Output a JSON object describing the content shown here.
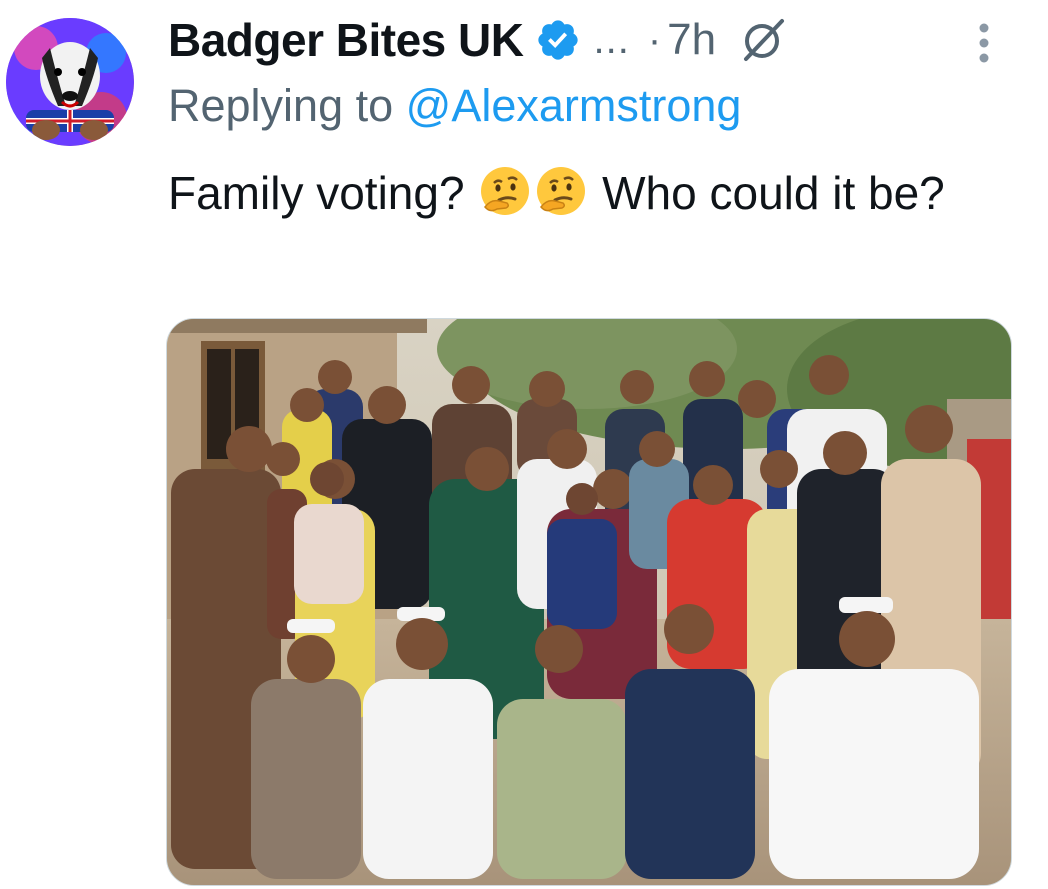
{
  "author": {
    "display_name": "Badger Bites UK",
    "verified": true,
    "avatar_icon": "badger-avatar-icon"
  },
  "meta": {
    "ellipsis": "...",
    "separator": "·",
    "timestamp": "7h"
  },
  "reply": {
    "prefix": "Replying to",
    "handle": "@Alexarmstrong"
  },
  "tweet": {
    "text_part1": "Family voting?",
    "text_part2": "Who could it be?",
    "emojis": [
      "thinking-face-emoji",
      "thinking-face-emoji"
    ]
  },
  "media": {
    "type": "photo",
    "icon": "group-photo-image"
  },
  "icons": {
    "verified": "verified-badge-icon",
    "grok": "grok-icon",
    "more": "more-vertical-icon"
  },
  "colors": {
    "text_primary": "#0f1419",
    "text_secondary": "#536471",
    "link_blue": "#1d9bf0",
    "verified_blue": "#1d9bf0"
  }
}
